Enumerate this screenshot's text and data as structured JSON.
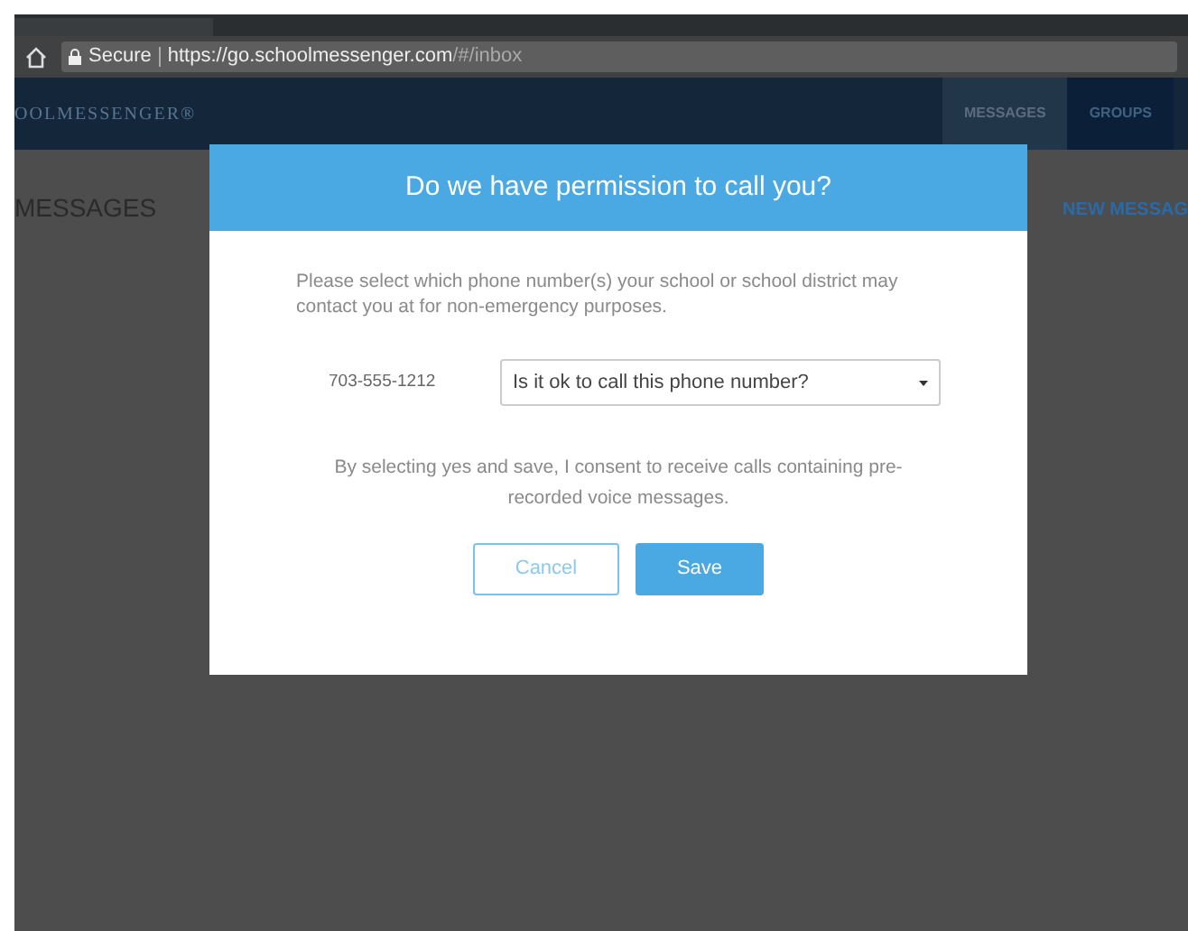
{
  "browser": {
    "secure_label": "Secure",
    "url_host": "https://go.schoolmessenger.com",
    "url_path": "/#/inbox"
  },
  "app": {
    "logo": "OOLMESSENGER®",
    "nav": [
      {
        "label": "MESSAGES",
        "selected": true
      },
      {
        "label": "GROUPS",
        "selected": false
      }
    ],
    "page_title": "MESSAGES",
    "new_message": "NEW MESSAG"
  },
  "dialog": {
    "title": "Do we have permission to call you?",
    "intro": "Please select which phone number(s) your school or school district may contact you at for non-emergency purposes.",
    "phone": "703-555-1212",
    "select_placeholder": "Is it ok to call this phone number?",
    "consent": "By selecting yes and save, I consent to receive calls containing pre-recorded voice messages.",
    "buttons": [
      {
        "label": "Cancel",
        "kind": "secondary"
      },
      {
        "label": "Save",
        "kind": "primary"
      }
    ]
  }
}
